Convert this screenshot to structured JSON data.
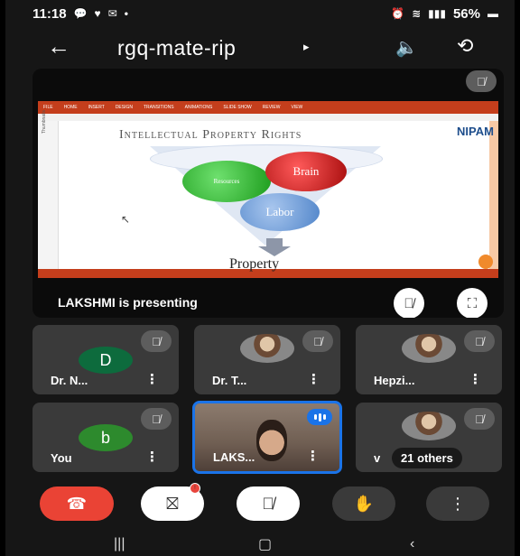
{
  "status_bar": {
    "time": "11:18",
    "battery": "56%",
    "left_icons": [
      "chat-icon",
      "heart-icon",
      "mail-icon",
      "dot"
    ],
    "right_icons": [
      "alarm-icon",
      "wifi-icon",
      "signal-icon",
      "battery-icon"
    ]
  },
  "meeting": {
    "title": "rgq-mate-rip"
  },
  "presentation": {
    "presenter_text": "LAKSHMI is presenting",
    "slide": {
      "title": "Intellectual Property Rights",
      "logo": "NIPAM",
      "circles": [
        "Resources",
        "Brain",
        "Labor"
      ],
      "footer": "Property",
      "ribbon_tabs": [
        "FILE",
        "HOME",
        "INSERT",
        "DESIGN",
        "TRANSITIONS",
        "ANIMATIONS",
        "SLIDE SHOW",
        "REVIEW",
        "VIEW"
      ],
      "side_label": "Thumbnails"
    }
  },
  "participants": [
    {
      "name": "Dr. N...",
      "initial": "D",
      "avatar_color": "#0d6b3d",
      "muted": true
    },
    {
      "name": "Dr. T...",
      "initial": "",
      "muted": true,
      "photo": true
    },
    {
      "name": "Hepzi...",
      "initial": "",
      "muted": true,
      "photo": true
    },
    {
      "name": "You",
      "initial": "b",
      "avatar_color": "#2d8a2d",
      "muted": true
    },
    {
      "name": "LAKS...",
      "initial": "",
      "speaking": true,
      "video": true
    },
    {
      "name": "21 others",
      "prefix": "v",
      "muted": true,
      "photo": true
    }
  ],
  "controls": {
    "end_call_color": "#ea4335",
    "camera_badge": "!"
  },
  "colors": {
    "accent": "#1a73e8",
    "tile_bg": "#3a3a3a",
    "background": "#161616"
  }
}
